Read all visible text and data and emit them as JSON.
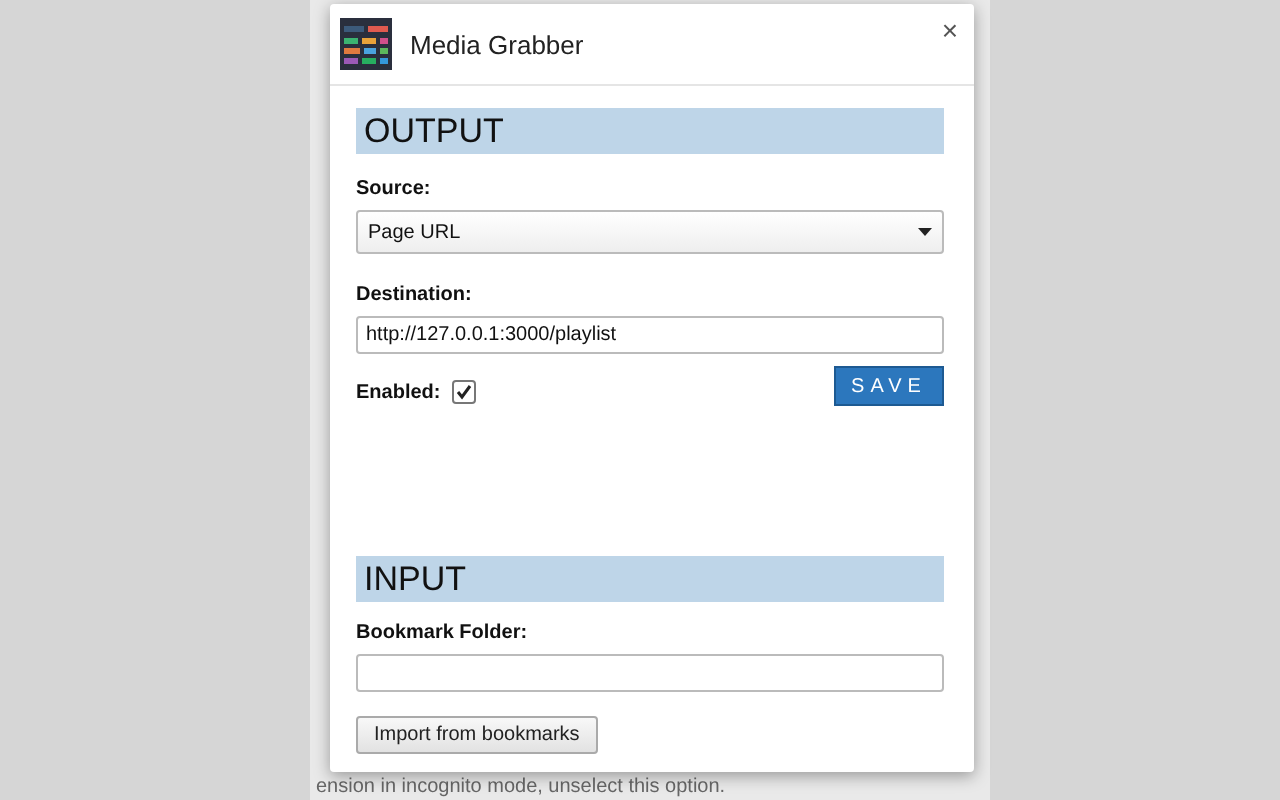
{
  "background_text": "ension in incognito mode, unselect this option.",
  "popup": {
    "title": "Media Grabber",
    "close": "×"
  },
  "output": {
    "heading": "OUTPUT",
    "source_label": "Source:",
    "source_value": "Page URL",
    "destination_label": "Destination:",
    "destination_value": "http://127.0.0.1:3000/playlist",
    "enabled_label": "Enabled:",
    "enabled_checked": true,
    "save": "SAVE"
  },
  "input": {
    "heading": "INPUT",
    "folder_label": "Bookmark Folder:",
    "import": "Import from bookmarks"
  }
}
